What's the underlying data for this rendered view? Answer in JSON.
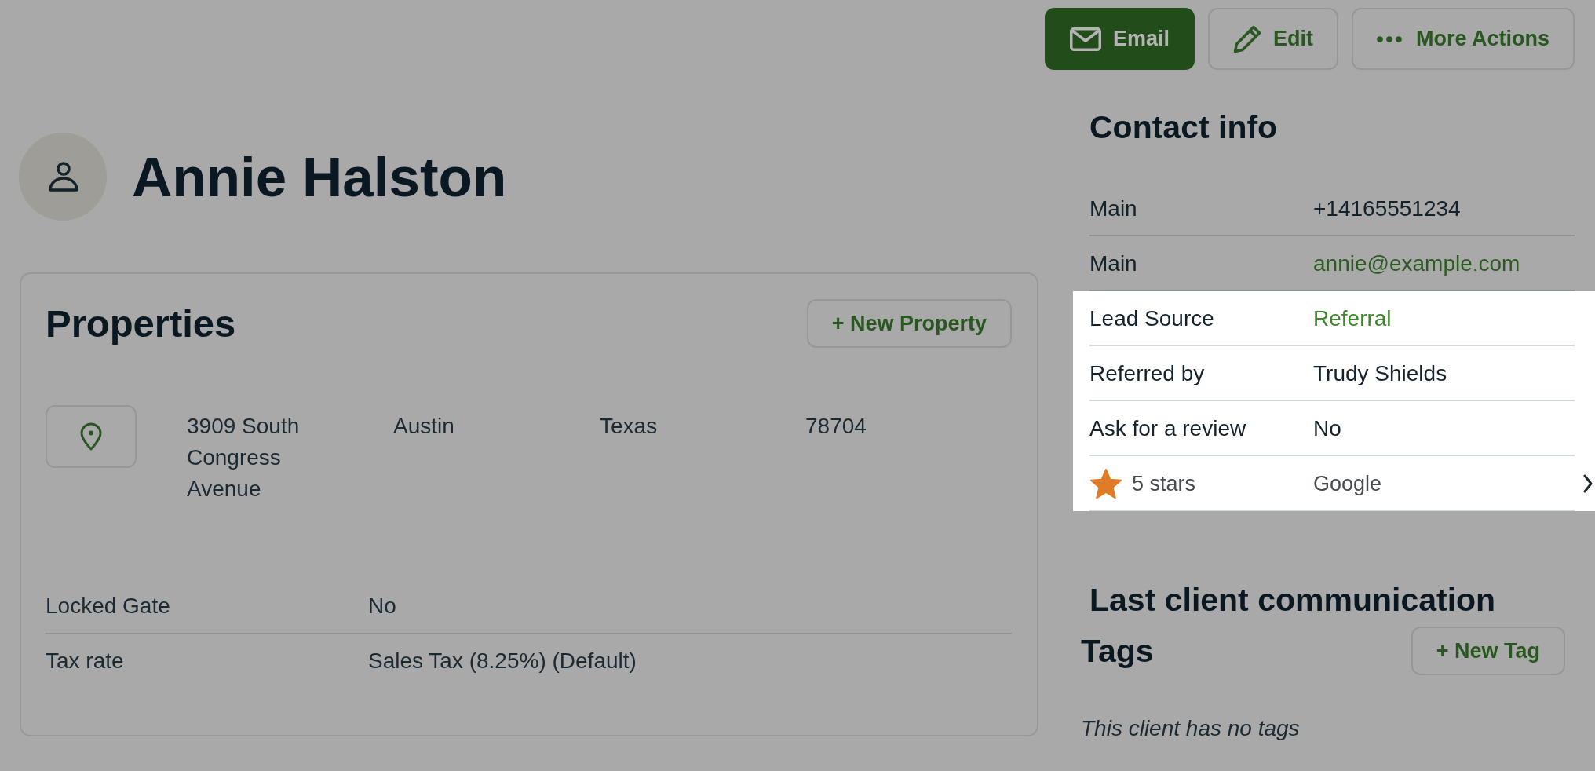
{
  "actions": [
    {
      "kind": "email",
      "label": "Email",
      "primary": true
    },
    {
      "kind": "edit",
      "label": "Edit",
      "primary": false
    },
    {
      "kind": "more",
      "label": "More Actions",
      "primary": false
    }
  ],
  "client": {
    "name": "Annie Halston"
  },
  "properties": {
    "title": "Properties",
    "new_button": "+ New Property",
    "items": [
      {
        "address": "3909 South Congress Avenue",
        "city": "Austin",
        "state": "Texas",
        "zip": "78704"
      }
    ],
    "fields": [
      {
        "label": "Locked Gate",
        "value": "No"
      },
      {
        "label": "Tax rate",
        "value": "Sales Tax (8.25%) (Default)"
      }
    ]
  },
  "contact_info": {
    "title": "Contact info",
    "rows": [
      {
        "kind": "text",
        "label": "Main",
        "value": "+14165551234",
        "highlighted": false
      },
      {
        "kind": "link",
        "label": "Main",
        "value": "annie@example.com",
        "highlighted": false
      },
      {
        "kind": "link",
        "label": "Lead Source",
        "value": "Referral",
        "highlighted": true
      },
      {
        "kind": "text",
        "label": "Referred by",
        "value": "Trudy Shields",
        "highlighted": true
      },
      {
        "kind": "text",
        "label": "Ask for a review",
        "value": "No",
        "highlighted": true
      },
      {
        "kind": "rating",
        "label": "5 stars",
        "value": "Google",
        "highlighted": true
      }
    ]
  },
  "last_communication": {
    "title": "Last client communication"
  },
  "tags": {
    "title": "Tags",
    "new_button": "+ New Tag",
    "empty_text": "This client has no tags"
  }
}
